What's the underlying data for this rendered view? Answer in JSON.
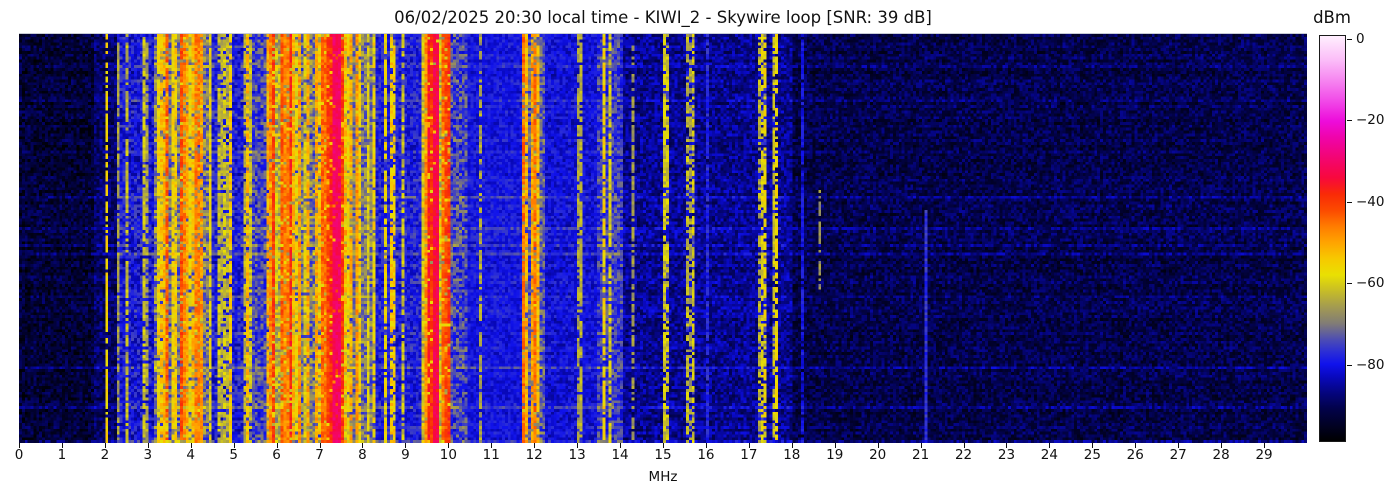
{
  "chart_data": {
    "type": "heatmap",
    "title": "06/02/2025 20:30 local time - KIWI_2 - Skywire loop [SNR: 39 dB]",
    "xlabel": "MHz",
    "colorbar_label": "dBm",
    "x_range_mhz": [
      0,
      30
    ],
    "x_ticks": [
      0,
      1,
      2,
      3,
      4,
      5,
      6,
      7,
      8,
      9,
      10,
      11,
      12,
      13,
      14,
      15,
      16,
      17,
      18,
      19,
      20,
      21,
      22,
      23,
      24,
      25,
      26,
      27,
      28,
      29
    ],
    "value_range_dbm": [
      -99,
      1
    ],
    "colorbar_ticks": [
      {
        "dbm": 0,
        "label": "0"
      },
      {
        "dbm": -20,
        "label": "−20"
      },
      {
        "dbm": -40,
        "label": "−40"
      },
      {
        "dbm": -60,
        "label": "−60"
      },
      {
        "dbm": -80,
        "label": "−80"
      }
    ],
    "grid": false,
    "legend": false,
    "time_rows": 144,
    "freq_bins": 448,
    "seed": 1337,
    "colormap_stops": [
      {
        "dbm": -99,
        "color": "#000000"
      },
      {
        "dbm": -95,
        "color": "#010125"
      },
      {
        "dbm": -91,
        "color": "#02024a"
      },
      {
        "dbm": -87,
        "color": "#050580"
      },
      {
        "dbm": -83,
        "color": "#0909c0"
      },
      {
        "dbm": -80,
        "color": "#1012ec"
      },
      {
        "dbm": -77,
        "color": "#2b2ed6"
      },
      {
        "dbm": -74,
        "color": "#4c4cb4"
      },
      {
        "dbm": -70,
        "color": "#817c76"
      },
      {
        "dbm": -66,
        "color": "#a29a52"
      },
      {
        "dbm": -62,
        "color": "#c6bc28"
      },
      {
        "dbm": -58,
        "color": "#e9e002"
      },
      {
        "dbm": -54,
        "color": "#f7c900"
      },
      {
        "dbm": -50,
        "color": "#ffa400"
      },
      {
        "dbm": -46,
        "color": "#ff7c00"
      },
      {
        "dbm": -42,
        "color": "#fc4a00"
      },
      {
        "dbm": -38,
        "color": "#f92a07"
      },
      {
        "dbm": -34,
        "color": "#f8083d"
      },
      {
        "dbm": -29,
        "color": "#f30573"
      },
      {
        "dbm": -24,
        "color": "#ef04ab"
      },
      {
        "dbm": -20,
        "color": "#ed0cdb"
      },
      {
        "dbm": -15,
        "color": "#f14ae8"
      },
      {
        "dbm": -10,
        "color": "#f685f0"
      },
      {
        "dbm": -5,
        "color": "#fbbcf8"
      },
      {
        "dbm": 1,
        "color": "#ffeffe"
      }
    ],
    "noise_floor_segments": [
      {
        "f0": 0.0,
        "f1": 1.75,
        "dbm": -93,
        "jitter": 5
      },
      {
        "f0": 1.75,
        "f1": 2.3,
        "dbm": -89,
        "jitter": 5
      },
      {
        "f0": 2.3,
        "f1": 3.12,
        "dbm": -80,
        "jitter": 6
      },
      {
        "f0": 3.12,
        "f1": 4.5,
        "dbm": -70,
        "jitter": 8
      },
      {
        "f0": 4.5,
        "f1": 5.3,
        "dbm": -79,
        "jitter": 6
      },
      {
        "f0": 5.3,
        "f1": 5.85,
        "dbm": -75,
        "jitter": 7
      },
      {
        "f0": 5.85,
        "f1": 6.35,
        "dbm": -63,
        "jitter": 8
      },
      {
        "f0": 6.35,
        "f1": 7.02,
        "dbm": -70,
        "jitter": 8
      },
      {
        "f0": 7.02,
        "f1": 7.65,
        "dbm": -56,
        "jitter": 8
      },
      {
        "f0": 7.65,
        "f1": 8.3,
        "dbm": -70,
        "jitter": 7
      },
      {
        "f0": 8.3,
        "f1": 9.35,
        "dbm": -79,
        "jitter": 5
      },
      {
        "f0": 9.35,
        "f1": 10.05,
        "dbm": -61,
        "jitter": 8
      },
      {
        "f0": 10.05,
        "f1": 10.45,
        "dbm": -75,
        "jitter": 7
      },
      {
        "f0": 10.45,
        "f1": 11.75,
        "dbm": -80,
        "jitter": 3.5
      },
      {
        "f0": 11.75,
        "f1": 12.25,
        "dbm": -73,
        "jitter": 7
      },
      {
        "f0": 12.25,
        "f1": 13.45,
        "dbm": -81,
        "jitter": 4
      },
      {
        "f0": 13.45,
        "f1": 14.05,
        "dbm": -76,
        "jitter": 6
      },
      {
        "f0": 14.05,
        "f1": 18.0,
        "dbm": -86,
        "jitter": 5
      },
      {
        "f0": 18.0,
        "f1": 30.0,
        "dbm": -91,
        "jitter": 5
      }
    ],
    "signal_bands": [
      {
        "f0": 2.3,
        "f1": 3.12,
        "stripe_density": 0.45,
        "dbm_min": -68,
        "dbm_max": -54,
        "fade": 0.5
      },
      {
        "f0": 3.12,
        "f1": 4.5,
        "stripe_density": 0.7,
        "dbm_min": -58,
        "dbm_max": -38,
        "fade": 0.4
      },
      {
        "f0": 4.6,
        "f1": 5.4,
        "stripe_density": 0.35,
        "dbm_min": -66,
        "dbm_max": -50,
        "fade": 0.5
      },
      {
        "f0": 5.4,
        "f1": 5.85,
        "stripe_density": 0.45,
        "dbm_min": -62,
        "dbm_max": -50,
        "fade": 0.45
      },
      {
        "f0": 5.85,
        "f1": 6.35,
        "stripe_density": 0.75,
        "dbm_min": -52,
        "dbm_max": -37,
        "fade": 0.3
      },
      {
        "f0": 6.35,
        "f1": 7.02,
        "stripe_density": 0.5,
        "dbm_min": -60,
        "dbm_max": -46,
        "fade": 0.4
      },
      {
        "f0": 7.02,
        "f1": 7.65,
        "stripe_density": 0.85,
        "dbm_min": -46,
        "dbm_max": -32,
        "fade": 0.22
      },
      {
        "f0": 7.65,
        "f1": 8.3,
        "stripe_density": 0.5,
        "dbm_min": -60,
        "dbm_max": -47,
        "fade": 0.4
      },
      {
        "f0": 8.3,
        "f1": 9.35,
        "stripe_density": 0.22,
        "dbm_min": -64,
        "dbm_max": -52,
        "fade": 0.55
      },
      {
        "f0": 9.35,
        "f1": 10.05,
        "stripe_density": 0.8,
        "dbm_min": -50,
        "dbm_max": -33,
        "fade": 0.28
      },
      {
        "f0": 10.45,
        "f1": 11.7,
        "stripe_density": 0.05,
        "dbm_min": -72,
        "dbm_max": -64,
        "fade": 0.6
      },
      {
        "f0": 11.75,
        "f1": 12.25,
        "stripe_density": 0.6,
        "dbm_min": -58,
        "dbm_max": -43,
        "fade": 0.4
      },
      {
        "f0": 12.25,
        "f1": 13.45,
        "stripe_density": 0.05,
        "dbm_min": -70,
        "dbm_max": -62,
        "fade": 0.5
      },
      {
        "f0": 13.45,
        "f1": 14.05,
        "stripe_density": 0.55,
        "dbm_min": -62,
        "dbm_max": -49,
        "fade": 0.5
      },
      {
        "f0": 14.85,
        "f1": 15.75,
        "stripe_density": 0.28,
        "dbm_min": -67,
        "dbm_max": -55,
        "fade": 0.7
      },
      {
        "f0": 17.1,
        "f1": 17.95,
        "stripe_density": 0.3,
        "dbm_min": -67,
        "dbm_max": -55,
        "fade": 0.7
      }
    ],
    "carriers": [
      {
        "mhz": 2.05,
        "dbm": -56,
        "fade": 0.45,
        "row_start": 0,
        "row_end": 1,
        "width_bins": 1
      },
      {
        "mhz": 7.33,
        "dbm": -31,
        "fade": 0.1,
        "row_start": 0,
        "row_end": 1,
        "width_bins": 3
      },
      {
        "mhz": 9.7,
        "dbm": -33,
        "fade": 0.12,
        "row_start": 0,
        "row_end": 1,
        "width_bins": 2
      },
      {
        "mhz": 13.12,
        "dbm": -63,
        "fade": 0.55,
        "row_start": 0,
        "row_end": 1,
        "width_bins": 1
      },
      {
        "mhz": 14.27,
        "dbm": -66,
        "fade": 0.7,
        "row_start": 0,
        "row_end": 1,
        "width_bins": 1
      },
      {
        "mhz": 15.0,
        "dbm": -60,
        "fade": 0.65,
        "row_start": 0,
        "row_end": 1,
        "width_bins": 1
      },
      {
        "mhz": 16.05,
        "dbm": -78,
        "fade": 0.35,
        "row_start": 0,
        "row_end": 1,
        "width_bins": 1
      },
      {
        "mhz": 17.62,
        "dbm": -57,
        "fade": 0.6,
        "row_start": 0,
        "row_end": 1,
        "width_bins": 1
      },
      {
        "mhz": 18.28,
        "dbm": -80,
        "fade": 0.3,
        "row_start": 0,
        "row_end": 1,
        "width_bins": 1
      },
      {
        "mhz": 18.63,
        "dbm": -67,
        "fade": 0.6,
        "row_start": 0.38,
        "row_end": 0.62,
        "width_bins": 1
      },
      {
        "mhz": 21.12,
        "dbm": -77,
        "fade": 0.05,
        "row_start": 0.43,
        "row_end": 1,
        "width_bins": 1
      }
    ]
  }
}
